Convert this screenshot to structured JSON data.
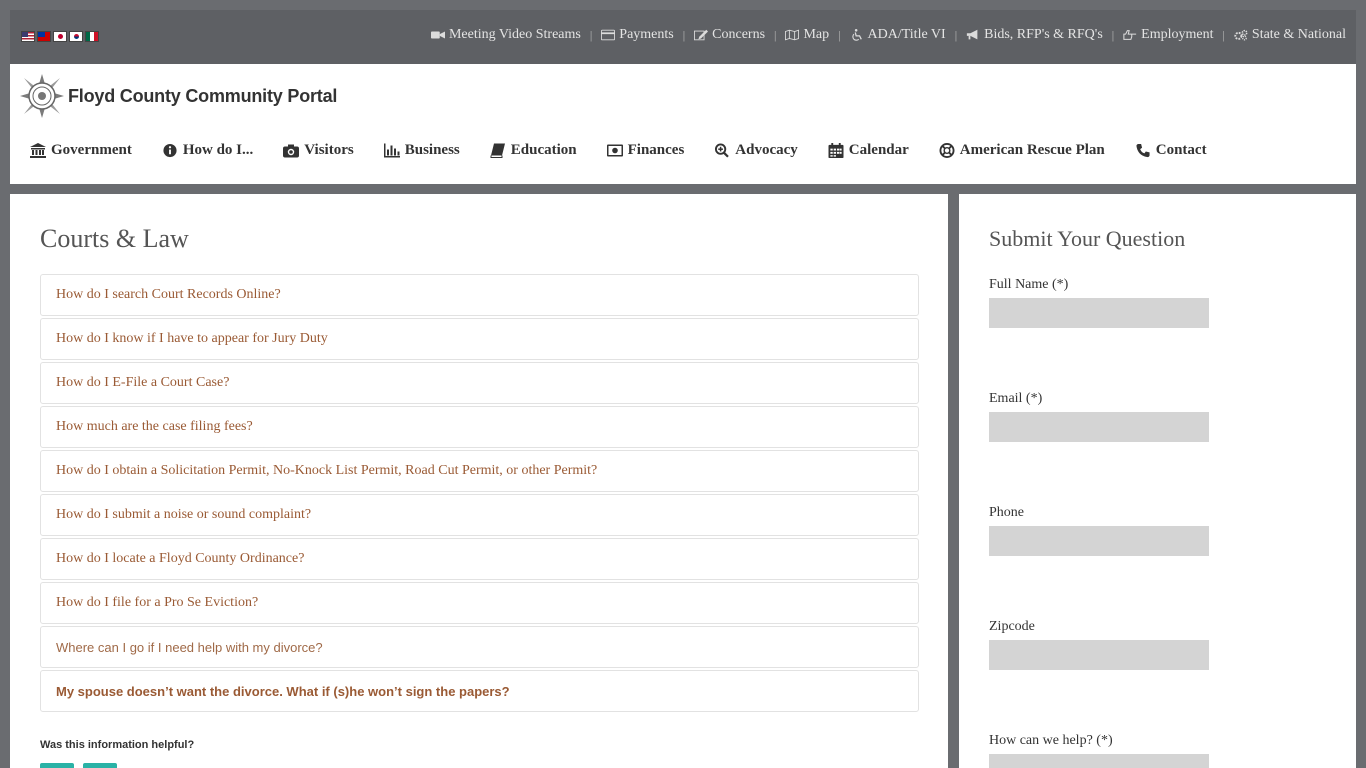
{
  "language_flags": [
    "us-flag",
    "taiwan-flag",
    "japan-flag",
    "korea-flag",
    "mexico-flag"
  ],
  "utility_nav": [
    {
      "label": "Meeting Video Streams",
      "icon": "video-camera-icon"
    },
    {
      "label": "Payments",
      "icon": "credit-card-icon"
    },
    {
      "label": "Concerns",
      "icon": "edit-icon"
    },
    {
      "label": "Map",
      "icon": "map-icon"
    },
    {
      "label": "ADA/Title VI",
      "icon": "wheelchair-icon"
    },
    {
      "label": "Bids, RFP's & RFQ's",
      "icon": "bullhorn-icon"
    },
    {
      "label": "Employment",
      "icon": "hand-pointing-icon"
    },
    {
      "label": "State & National",
      "icon": "gears-icon"
    }
  ],
  "site": {
    "title": "Floyd County Community Portal"
  },
  "main_nav": [
    {
      "label": "Government",
      "icon": "bank-icon"
    },
    {
      "label": "How do I...",
      "icon": "info-circle-icon"
    },
    {
      "label": "Visitors",
      "icon": "camera-icon"
    },
    {
      "label": "Business",
      "icon": "bar-chart-icon"
    },
    {
      "label": "Education",
      "icon": "book-icon"
    },
    {
      "label": "Finances",
      "icon": "money-icon"
    },
    {
      "label": "Advocacy",
      "icon": "search-plus-icon"
    },
    {
      "label": "Calendar",
      "icon": "calendar-icon"
    },
    {
      "label": "American Rescue Plan",
      "icon": "life-ring-icon"
    },
    {
      "label": "Contact",
      "icon": "phone-icon"
    }
  ],
  "page": {
    "title": "Courts & Law",
    "faqs": [
      "How do I search Court Records Online?",
      "How do I know if I have to appear for Jury Duty",
      "How do I E-File a Court Case?",
      "How much are the case filing fees?",
      "How do I obtain a Solicitation Permit, No-Knock List Permit, Road Cut Permit, or other Permit?",
      "How do I submit a noise or sound complaint?",
      "How do I locate a Floyd County Ordinance?",
      "How do I file for a Pro Se Eviction?",
      "Where can I go if I need help with my divorce?",
      "My spouse doesn’t want the divorce. What if (s)he won’t sign the papers?"
    ],
    "helpful_question": "Was this information helpful?"
  },
  "sidebar": {
    "title": "Submit Your Question",
    "fields": {
      "full_name": {
        "label": "Full Name (*)",
        "value": ""
      },
      "email": {
        "label": "Email (*)",
        "value": ""
      },
      "phone": {
        "label": "Phone",
        "value": ""
      },
      "zipcode": {
        "label": "Zipcode",
        "value": ""
      },
      "help": {
        "label": "How can we help? (*)",
        "value": ""
      }
    }
  },
  "colors": {
    "frame": "#6a6c70",
    "topbar": "#5e6064",
    "faq_link": "#9a5a34",
    "input_bg": "#d4d4d4",
    "helpful_button": "#2ab2a6"
  }
}
